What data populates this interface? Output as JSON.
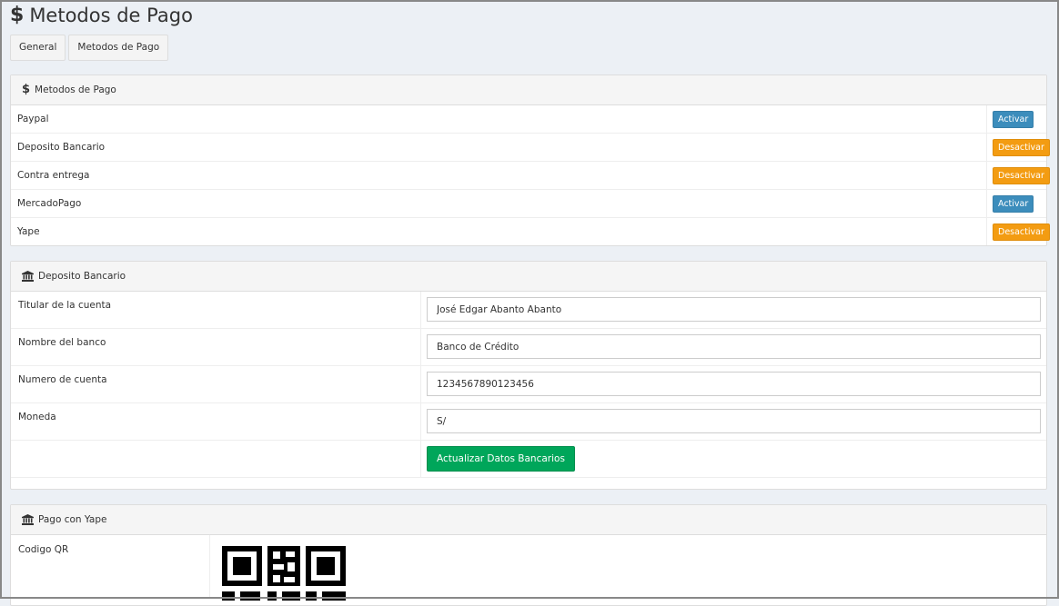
{
  "page": {
    "title": "Metodos de Pago",
    "title_icon": "dollar-icon"
  },
  "tabs": [
    {
      "label": "General"
    },
    {
      "label": "Metodos de Pago"
    }
  ],
  "methods_panel": {
    "title": "Metodos de Pago",
    "rows": [
      {
        "name": "Paypal",
        "action": "Activar"
      },
      {
        "name": "Deposito Bancario",
        "action": "Desactivar"
      },
      {
        "name": "Contra entrega",
        "action": "Desactivar"
      },
      {
        "name": "MercadoPago",
        "action": "Activar"
      },
      {
        "name": "Yape",
        "action": "Desactivar"
      }
    ]
  },
  "bank_panel": {
    "title": "Deposito Bancario",
    "fields": [
      {
        "label": "Titular de la cuenta",
        "value": "José Edgar Abanto Abanto"
      },
      {
        "label": "Nombre del banco",
        "value": "Banco de Crédito"
      },
      {
        "label": "Numero de cuenta",
        "value": "1234567890123456"
      },
      {
        "label": "Moneda",
        "value": "S/"
      }
    ],
    "submit_label": "Actualizar Datos Bancarios"
  },
  "yape_panel": {
    "title": "Pago con Yape",
    "qr_label": "Codigo QR"
  },
  "colors": {
    "activar": "#3c8dbc",
    "desactivar": "#f39c12",
    "success": "#00a65a",
    "background": "#ecf0f5"
  }
}
